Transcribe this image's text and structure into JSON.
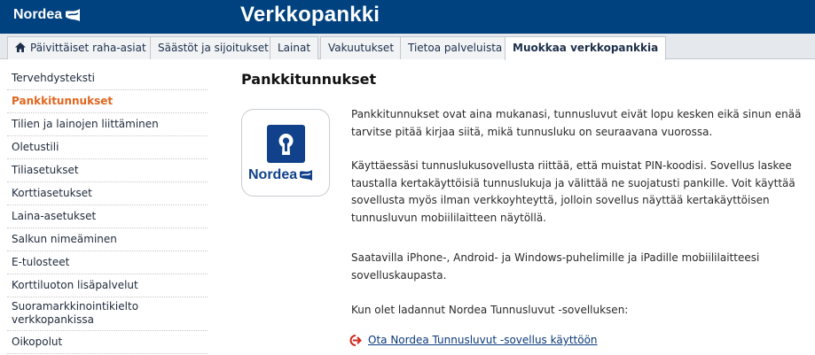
{
  "brand": {
    "logo_text": "Nordea",
    "app_title": "Verkkopankki"
  },
  "nav": {
    "tabs": [
      {
        "label": "Päivittäiset raha-asiat",
        "icon": "home-icon"
      },
      {
        "label": "Säästöt ja sijoitukset"
      },
      {
        "label": "Lainat"
      },
      {
        "label": "Vakuutukset"
      },
      {
        "label": "Tietoa palveluista"
      },
      {
        "label": "Muokkaa verkkopankkia",
        "active": true
      }
    ]
  },
  "sidebar": {
    "items": [
      {
        "label": "Tervehdysteksti"
      },
      {
        "label": "Pankkitunnukset",
        "active": true
      },
      {
        "label": "Tilien ja lainojen liittäminen"
      },
      {
        "label": "Oletustili"
      },
      {
        "label": "Tiliasetukset"
      },
      {
        "label": "Korttiasetukset"
      },
      {
        "label": "Laina-asetukset"
      },
      {
        "label": "Salkun nimeäminen"
      },
      {
        "label": "E-tulosteet"
      },
      {
        "label": "Korttiluoton lisäpalvelut"
      },
      {
        "label": "Suoramarkkinointikielto verkkopankissa"
      },
      {
        "label": "Oikopolut"
      }
    ]
  },
  "main": {
    "title": "Pankkitunnukset",
    "app_icon": {
      "brand_text": "Nordea",
      "icon": "keyhole-lock-icon"
    },
    "paragraphs": [
      "Pankkitunnukset ovat aina mukanasi, tunnusluvut eivät lopu kesken eikä sinun enää tarvitse pitää kirjaa siitä, mikä tunnusluku on seuraavana vuorossa.",
      "Käyttäessäsi tunnuslukusovellusta riittää, että muistat PIN-koodisi. Sovellus laskee taustalla kertakäyttöisiä tunnuslukuja ja välittää ne suojatusti pankille. Voit käyttää sovellusta myös ilman verkkoyhteyttä, jolloin sovellus näyttää kertakäyttöisen tunnusluvun mobiililaitteen näytöllä.",
      "Saatavilla iPhone-, Android- ja Windows-puhelimille ja iPadille mobiililaitteesi sovelluskaupasta.",
      "Kun olet ladannut Nordea Tunnusluvut -sovelluksen:"
    ],
    "cta": {
      "label": "Ota Nordea Tunnusluvut -sovellus käyttöön",
      "icon": "arrow-right-circle-icon"
    }
  },
  "colors": {
    "header_bg": "#00427f",
    "nav_bg": "#e5e8ec",
    "active_sidebar": "#e0661f",
    "link": "#0b3a7a",
    "cta_arrow": "#d0281f"
  }
}
